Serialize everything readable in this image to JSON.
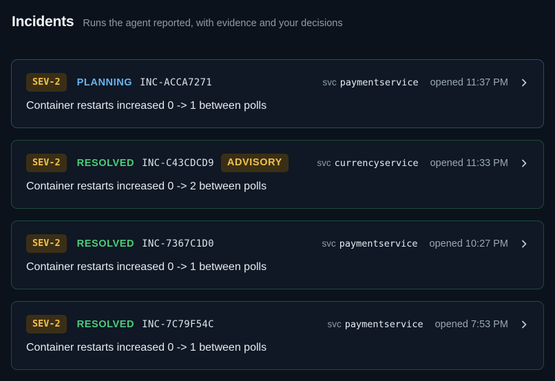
{
  "header": {
    "title": "Incidents",
    "subtitle": "Runs the agent reported, with evidence and your decisions"
  },
  "incidents": [
    {
      "severity": "SEV-2",
      "status": "PLANNING",
      "id": "INC-ACCA7271",
      "advisory": "",
      "svc_label": "svc",
      "service": "paymentservice",
      "opened": "opened 11:37 PM",
      "description": "Container restarts increased 0 -> 1 between polls"
    },
    {
      "severity": "SEV-2",
      "status": "RESOLVED",
      "id": "INC-C43CDCD9",
      "advisory": "ADVISORY",
      "svc_label": "svc",
      "service": "currencyservice",
      "opened": "opened 11:33 PM",
      "description": "Container restarts increased 0 -> 2 between polls"
    },
    {
      "severity": "SEV-2",
      "status": "RESOLVED",
      "id": "INC-7367C1D0",
      "advisory": "",
      "svc_label": "svc",
      "service": "paymentservice",
      "opened": "opened 10:27 PM",
      "description": "Container restarts increased 0 -> 1 between polls"
    },
    {
      "severity": "SEV-2",
      "status": "RESOLVED",
      "id": "INC-7C79F54C",
      "advisory": "",
      "svc_label": "svc",
      "service": "paymentservice",
      "opened": "opened 7:53 PM",
      "description": "Container restarts increased 0 -> 1 between polls"
    }
  ],
  "colors": {
    "background": "#0b121b",
    "card": "#0f1824",
    "severity": "#f2c14b",
    "planning": "#69b4ec",
    "resolved": "#4ccc7a"
  },
  "icons": {
    "open": "chevron-right-icon"
  }
}
